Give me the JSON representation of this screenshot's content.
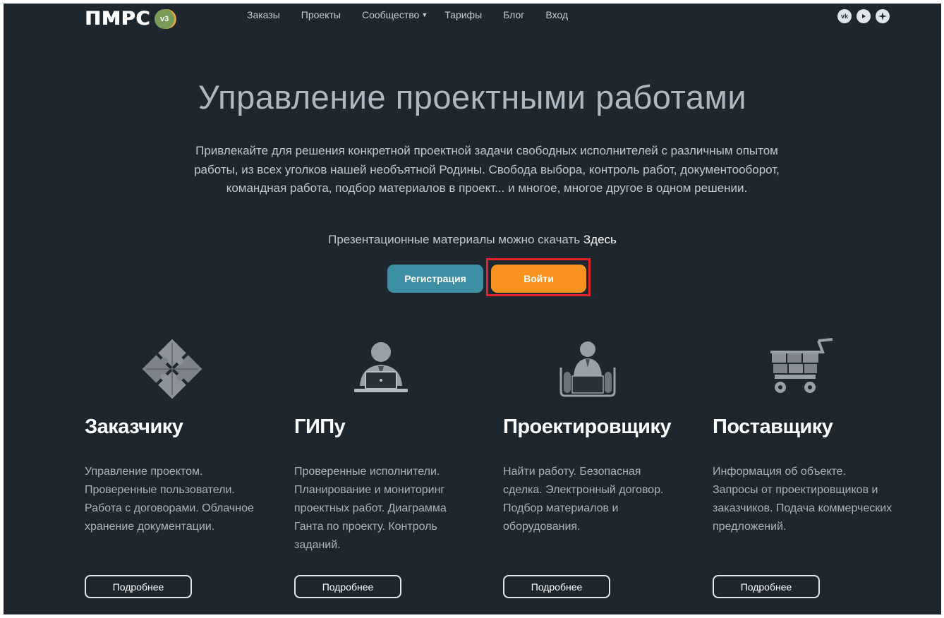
{
  "header": {
    "logo_text": "ПМРС",
    "logo_badge": "v3",
    "nav": [
      {
        "label": "Заказы"
      },
      {
        "label": "Проекты"
      },
      {
        "label": "Сообщество"
      },
      {
        "label": "Тарифы"
      },
      {
        "label": "Блог"
      },
      {
        "label": "Вход"
      }
    ],
    "socials": [
      "vk-icon",
      "youtube-icon",
      "star-icon"
    ]
  },
  "hero": {
    "title": "Управление проектными работами",
    "description": "Привлекайте для решения конкретной проектной задачи свободных исполнителей с различным опытом работы, из всех уголков нашей необъятной Родины. Свобода выбора, контроль работ, документооборот, командная работа, подбор материалов в проект... и многое, многое другое в одном решении.",
    "present_text": "Презентационные материалы можно скачать",
    "present_link": "Здесь",
    "register_label": "Регистрация",
    "login_label": "Войти"
  },
  "roles": [
    {
      "icon": "puzzle-icon",
      "title": "Заказчику",
      "text": "Управление проектом. Проверенные пользователи. Работа с договорами. Облачное хранение документации.",
      "button": "Подробнее"
    },
    {
      "icon": "manager-laptop-icon",
      "title": "ГИПу",
      "text": "Проверенные исполнители. Планирование и мониторинг проектных работ. Диаграмма Ганта по проекту. Контроль заданий.",
      "button": "Подробнее"
    },
    {
      "icon": "designer-blueprint-icon",
      "title": "Проектировщику",
      "text": "Найти работу. Безопасная сделка. Электронный договор. Подбор материалов и оборудования.",
      "button": "Подробнее"
    },
    {
      "icon": "shopping-cart-icon",
      "title": "Поставщику",
      "text": "Информация об объекте. Запросы от проектировщиков и заказчиков. Подача коммерческих предложений.",
      "button": "Подробнее"
    }
  ],
  "colors": {
    "background": "#1e272e",
    "register": "#3d8fa3",
    "login": "#f7931e",
    "highlight": "#e3242b"
  }
}
